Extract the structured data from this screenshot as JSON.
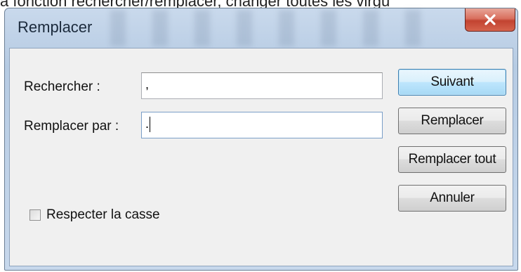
{
  "background_caption": "a fonction rechercher/remplacer, changer toutes les virgu",
  "dialog": {
    "title": "Remplacer",
    "close_icon": "close-icon",
    "find_label": "Rechercher :",
    "find_value": ",",
    "replace_label": "Remplacer par :",
    "replace_value": ".",
    "match_case_label": "Respecter la casse",
    "match_case_checked": false
  },
  "buttons": {
    "next": "Suivant",
    "replace": "Remplacer",
    "replace_all": "Remplacer tout",
    "cancel": "Annuler"
  },
  "colors": {
    "close_button": "#c24330",
    "default_button_border": "#3c7fb1"
  }
}
